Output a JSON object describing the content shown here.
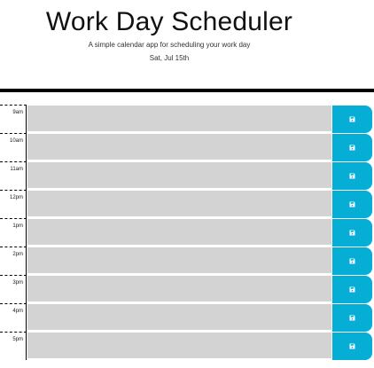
{
  "header": {
    "title": "Work Day Scheduler",
    "subtitle": "A simple calendar app for scheduling your work day",
    "current_day": "Sat, Jul 15th"
  },
  "colors": {
    "past": "#d3d3d3",
    "save_button": "#06aed5",
    "divider": "#000000"
  },
  "time_blocks": [
    {
      "hour": "9am",
      "description": "",
      "state": "past",
      "save_icon": "save-icon"
    },
    {
      "hour": "10am",
      "description": "",
      "state": "past",
      "save_icon": "save-icon"
    },
    {
      "hour": "11am",
      "description": "",
      "state": "past",
      "save_icon": "save-icon"
    },
    {
      "hour": "12pm",
      "description": "",
      "state": "past",
      "save_icon": "save-icon"
    },
    {
      "hour": "1pm",
      "description": "",
      "state": "past",
      "save_icon": "save-icon"
    },
    {
      "hour": "2pm",
      "description": "",
      "state": "past",
      "save_icon": "save-icon"
    },
    {
      "hour": "3pm",
      "description": "",
      "state": "past",
      "save_icon": "save-icon"
    },
    {
      "hour": "4pm",
      "description": "",
      "state": "past",
      "save_icon": "save-icon"
    },
    {
      "hour": "5pm",
      "description": "",
      "state": "past",
      "save_icon": "save-icon"
    }
  ]
}
